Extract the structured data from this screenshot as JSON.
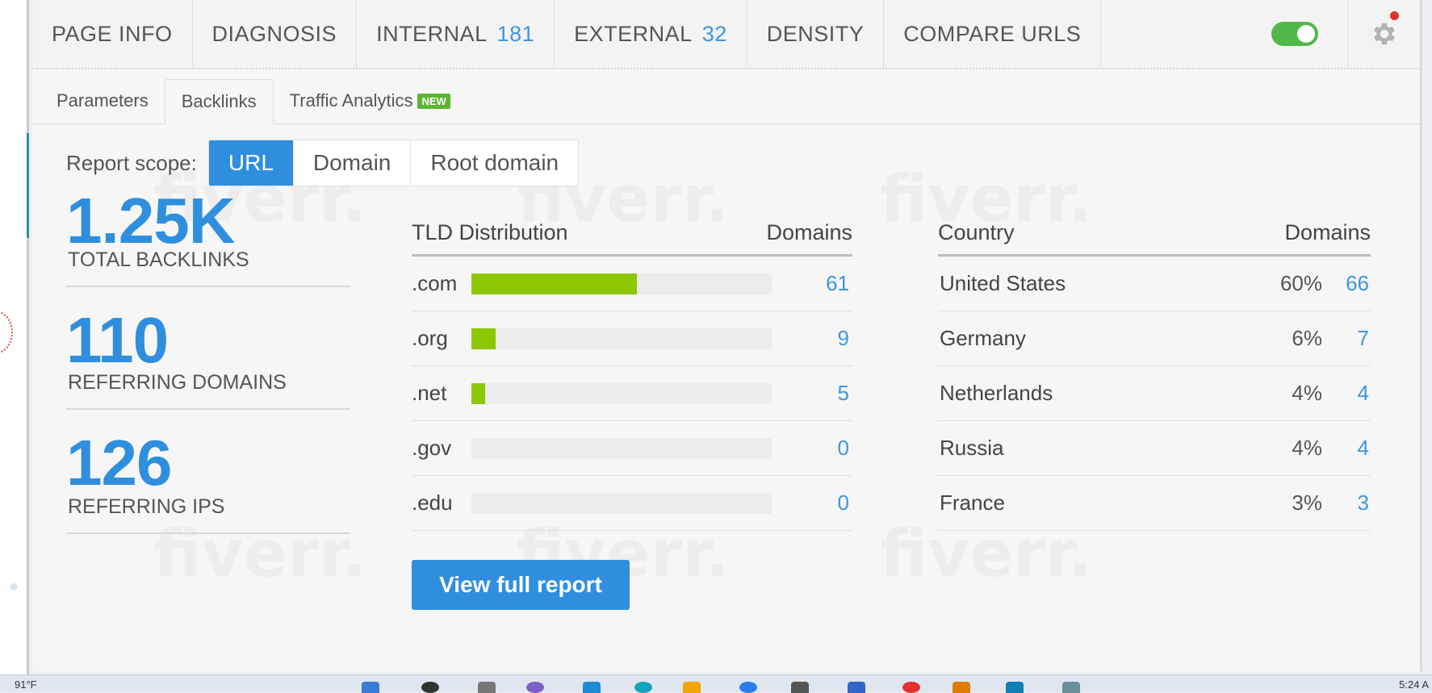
{
  "nav": {
    "tabs": [
      {
        "label": "PAGE INFO",
        "count": ""
      },
      {
        "label": "DIAGNOSIS",
        "count": ""
      },
      {
        "label": "INTERNAL",
        "count": "181"
      },
      {
        "label": "EXTERNAL",
        "count": "32"
      },
      {
        "label": "DENSITY",
        "count": ""
      },
      {
        "label": "COMPARE URLS",
        "count": ""
      }
    ],
    "toggle_on": true,
    "settings_icon": "gear-icon",
    "notification_color": "#e0332f"
  },
  "subtabs": {
    "items": [
      "Parameters",
      "Backlinks",
      "Traffic Analytics"
    ],
    "active": "Backlinks",
    "new_badge": "NEW"
  },
  "scope": {
    "label": "Report scope:",
    "options": [
      "URL",
      "Domain",
      "Root domain"
    ],
    "selected": "URL"
  },
  "stats": [
    {
      "value": "1.25K",
      "label": "TOTAL BACKLINKS"
    },
    {
      "value": "110",
      "label": "REFERRING DOMAINS"
    },
    {
      "value": "126",
      "label": "REFERRING IPS"
    }
  ],
  "tld": {
    "header": "TLD Distribution",
    "header_right": "Domains",
    "rows": [
      {
        "name": ".com",
        "value": "61",
        "share": 0.55
      },
      {
        "name": ".org",
        "value": "9",
        "share": 0.08
      },
      {
        "name": ".net",
        "value": "5",
        "share": 0.045
      },
      {
        "name": ".gov",
        "value": "0",
        "share": 0
      },
      {
        "name": ".edu",
        "value": "0",
        "share": 0
      }
    ]
  },
  "country": {
    "header": "Country",
    "header_right": "Domains",
    "rows": [
      {
        "name": "United States",
        "pct": "60%",
        "value": "66"
      },
      {
        "name": "Germany",
        "pct": "6%",
        "value": "7"
      },
      {
        "name": "Netherlands",
        "pct": "4%",
        "value": "4"
      },
      {
        "name": "Russia",
        "pct": "4%",
        "value": "4"
      },
      {
        "name": "France",
        "pct": "3%",
        "value": "3"
      }
    ]
  },
  "full_report_button": "View full report",
  "watermark_text": "fiverr.",
  "taskbar": {
    "temp": "91°F",
    "clock": "5:24 A"
  },
  "colors": {
    "accent": "#2f8fde",
    "bar": "#8dc700",
    "toggle": "#52b849",
    "new_badge": "#5cb531"
  }
}
